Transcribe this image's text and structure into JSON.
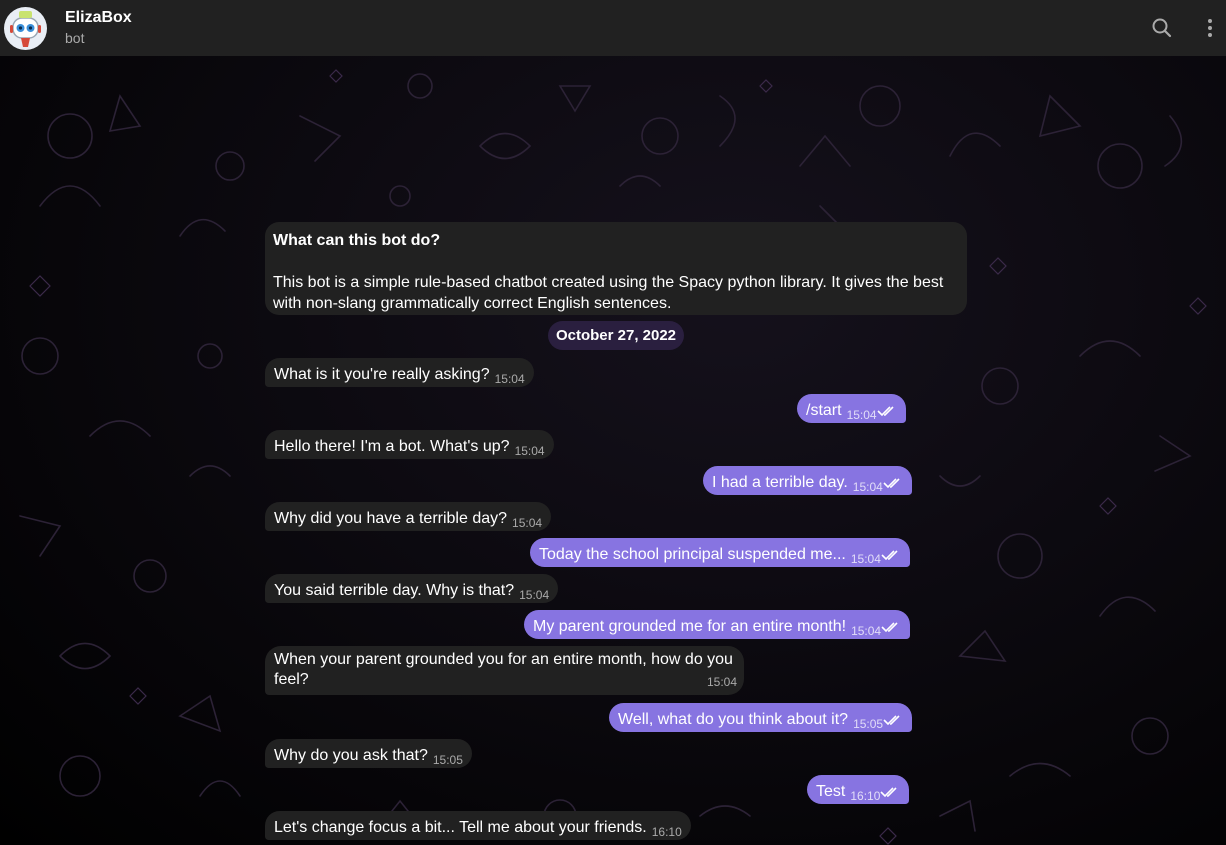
{
  "header": {
    "title": "ElizaBox",
    "subtitle": "bot",
    "icons": {
      "search": "search-icon",
      "more": "more-vertical-icon"
    }
  },
  "info": {
    "title": "What can this bot do?",
    "body_line1": "This bot is a simple rule-based chatbot created using the Spacy python library. It gives the best",
    "body_line2": "with non-slang grammatically correct English sentences."
  },
  "date": "October 27, 2022",
  "messages": [
    {
      "side": "in",
      "text": "What is it you're really asking?",
      "time": "15:04"
    },
    {
      "side": "out",
      "text": "/start",
      "time": "15:04"
    },
    {
      "side": "in",
      "text": "Hello there! I'm a bot. What's up?",
      "time": "15:04"
    },
    {
      "side": "out",
      "text": "I had a terrible day.",
      "time": "15:04"
    },
    {
      "side": "in",
      "text": "Why did you have a terrible day?",
      "time": "15:04"
    },
    {
      "side": "out",
      "text": "Today the school principal suspended me...",
      "time": "15:04"
    },
    {
      "side": "in",
      "text": "You said terrible day. Why is that?",
      "time": "15:04"
    },
    {
      "side": "out",
      "text": "My parent grounded me for an entire month!",
      "time": "15:04"
    },
    {
      "side": "in",
      "text_line1": "When your parent grounded you for an entire month, how do you",
      "text_line2": "feel?",
      "time": "15:04"
    },
    {
      "side": "out",
      "text": "Well, what do you think about it?",
      "time": "15:05"
    },
    {
      "side": "in",
      "text": "Why do you ask that?",
      "time": "15:05"
    },
    {
      "side": "out",
      "text": "Test",
      "time": "16:10"
    },
    {
      "side": "in",
      "text": "Let's change focus a bit... Tell me about your friends.",
      "time": "16:10"
    }
  ],
  "colors": {
    "header_bg": "#212121",
    "incoming_bubble": "#212121",
    "outgoing_bubble": "#8774e1",
    "date_pill": "#2a1f3f"
  }
}
